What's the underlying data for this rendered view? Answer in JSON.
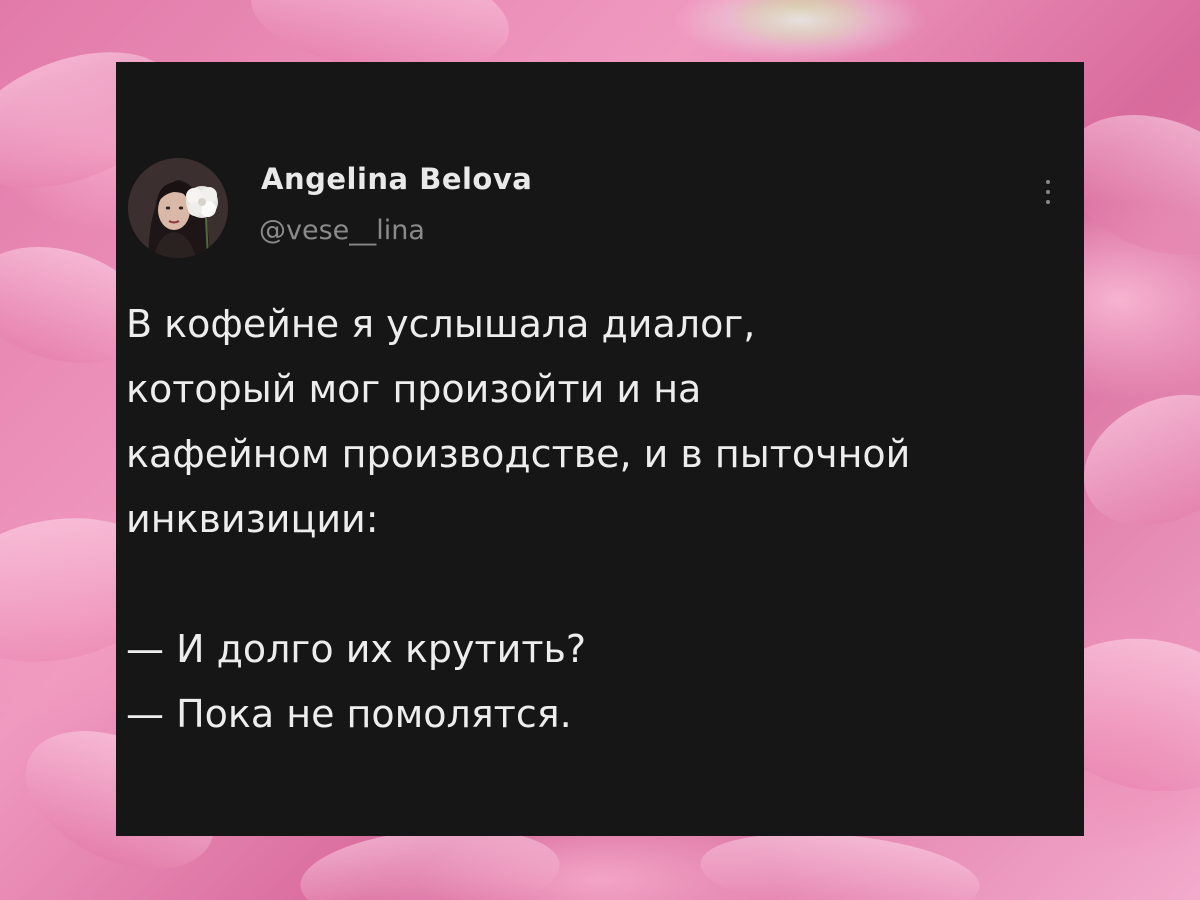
{
  "post": {
    "author_name": "Angelina Belova",
    "author_handle": "@vese__lina",
    "avatar_icon": "profile-photo",
    "menu_icon": "more-vertical-icon",
    "body_lines": [
      "В кофейне я услышала диалог,",
      "который мог произойти и на",
      "кафейном производстве, и в пыточной",
      "инквизиции:"
    ],
    "dialog_lines": [
      "— И долго их крутить?",
      "— Пока не помолятся."
    ]
  },
  "colors": {
    "card_background": "#161616",
    "text_primary": "#ededed",
    "text_secondary": "#8a8a8a",
    "background_accent": "#f09ac0"
  }
}
